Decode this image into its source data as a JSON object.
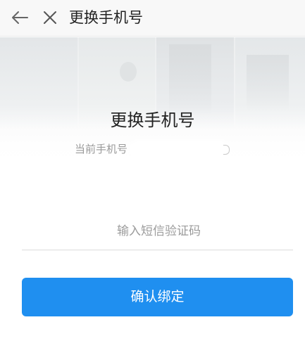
{
  "topbar": {
    "title": "更换手机号",
    "back_icon": "arrow-left-icon",
    "close_icon": "close-icon"
  },
  "main": {
    "title": "更换手机号",
    "current_phone_label": "当前手机号",
    "verification_code": {
      "value": "",
      "placeholder": "输入短信验证码"
    },
    "confirm_button_label": "确认绑定"
  },
  "colors": {
    "accent": "#1f8ff0",
    "topbar_background": "#f8f8f8",
    "muted_text": "#9a9a9a"
  }
}
